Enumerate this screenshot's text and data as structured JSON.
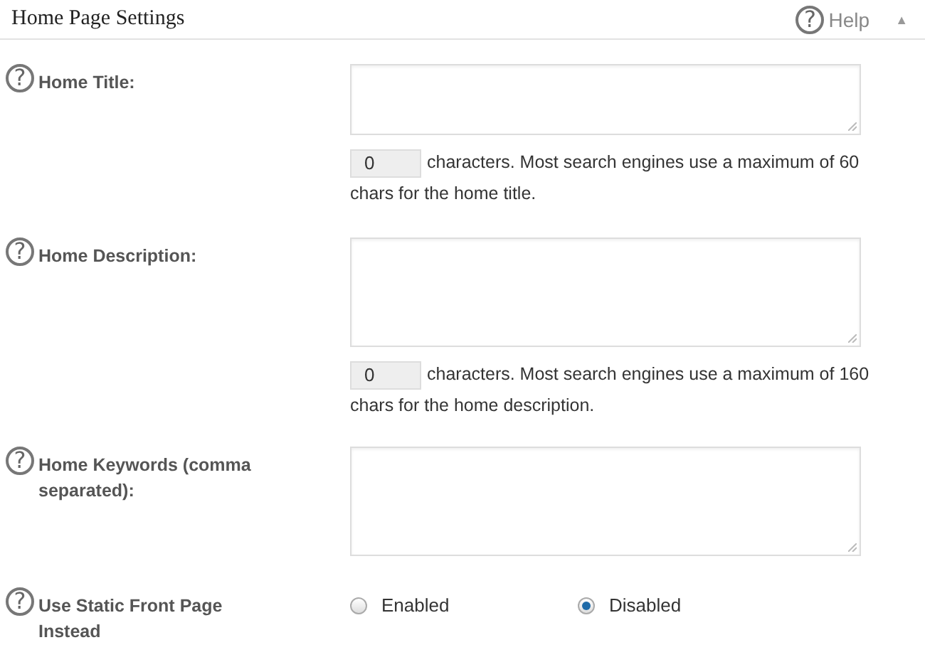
{
  "panel": {
    "title": "Home Page Settings",
    "help_mark": "?",
    "help": "Help",
    "collapse_icon": "▲"
  },
  "fields": [
    {
      "kind": "textarea",
      "help_mark": "?",
      "label": "Home Title:",
      "count": "0",
      "note": "characters. Most search engines use a maximum of 60 chars for the home title."
    },
    {
      "kind": "textarea",
      "help_mark": "?",
      "label": "Home Description:",
      "count": "0",
      "note": "characters. Most search engines use a maximum of 160 chars for the home description."
    },
    {
      "kind": "textarea",
      "help_mark": "?",
      "label": "Home Keywords (comma separated):"
    },
    {
      "kind": "radio",
      "help_mark": "?",
      "label": "Use Static Front Page Instead",
      "options": [
        {
          "label": "Enabled",
          "selected": false
        },
        {
          "label": "Disabled",
          "selected": true
        }
      ]
    }
  ]
}
